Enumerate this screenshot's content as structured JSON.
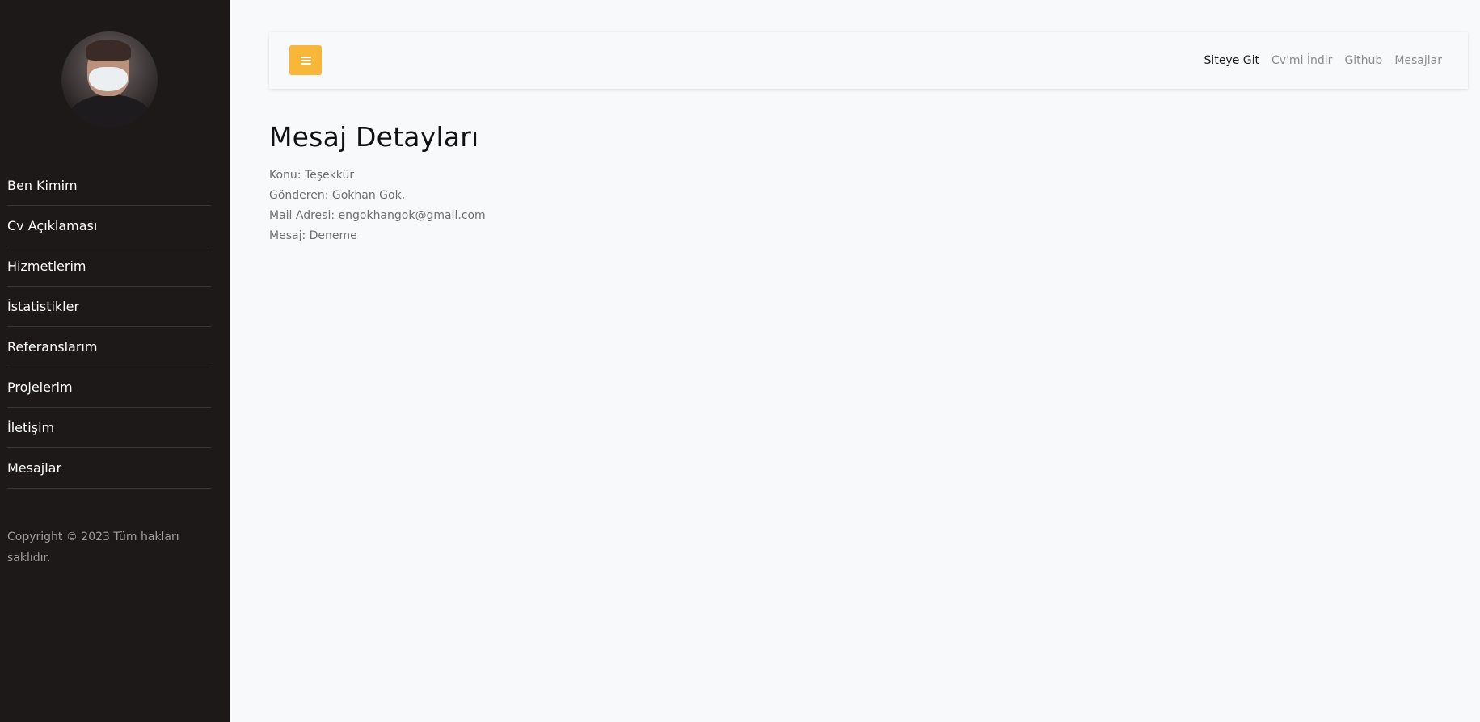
{
  "sidebar": {
    "items": [
      {
        "label": "Ben Kimim"
      },
      {
        "label": "Cv Açıklaması"
      },
      {
        "label": "Hizmetlerim"
      },
      {
        "label": "İstatistikler"
      },
      {
        "label": "Referanslarım"
      },
      {
        "label": "Projelerim"
      },
      {
        "label": "İletişim"
      },
      {
        "label": "Mesajlar"
      }
    ],
    "copyright": "Copyright © 2023 Tüm hakları saklıdır."
  },
  "topbar": {
    "menu_icon": "hamburger-menu-icon",
    "accent_color": "#f8b739",
    "links": [
      {
        "label": "Siteye Git"
      },
      {
        "label": "Cv'mi İndir"
      },
      {
        "label": "Github"
      },
      {
        "label": "Mesajlar"
      }
    ]
  },
  "main": {
    "title": "Mesaj Detayları",
    "subject": "Konu: Teşekkür",
    "sender": "Gönderen: Gokhan Gok,",
    "email": "Mail Adresi: engokhangok@gmail.com",
    "message": "Mesaj: Deneme"
  }
}
